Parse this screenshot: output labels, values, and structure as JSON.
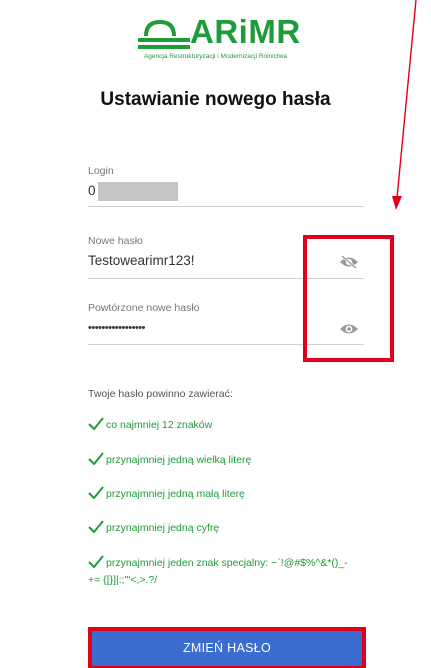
{
  "logo": {
    "name": "ARiMR",
    "subtitle": "Agencja Restrukturyzacji i Modernizacji Rolnictwa"
  },
  "title": "Ustawianie nowego hasła",
  "form": {
    "login": {
      "label": "Login",
      "value": "0"
    },
    "new_password": {
      "label": "Nowe hasło",
      "value": "Testowearimr123!"
    },
    "repeat_password": {
      "label": "Powtórzone nowe hasło",
      "value": "•••••••••••••••••"
    }
  },
  "requirements": {
    "heading": "Twoje hasło powinno zawierać:",
    "items": [
      "co najmniej 12 znaków",
      "przynajmniej jedną wielką literę",
      "przynajmniej jedną małą literę",
      "przynajmniej jedną cyfrę",
      "przynajmniej jeden znak specjalny: ~`!@#$%^&*()_-",
      "+= {[}]|:;\"'<,>.?/"
    ]
  },
  "submit_label": "ZMIEŃ HASŁO",
  "colors": {
    "brand_green": "#1e9b3a",
    "button_blue": "#3b6ccf",
    "annotation_red": "#e0001b"
  },
  "icons": {
    "new_password_toggle": "eye-slash-icon",
    "repeat_password_toggle": "eye-icon",
    "requirement": "checkmark-icon"
  }
}
